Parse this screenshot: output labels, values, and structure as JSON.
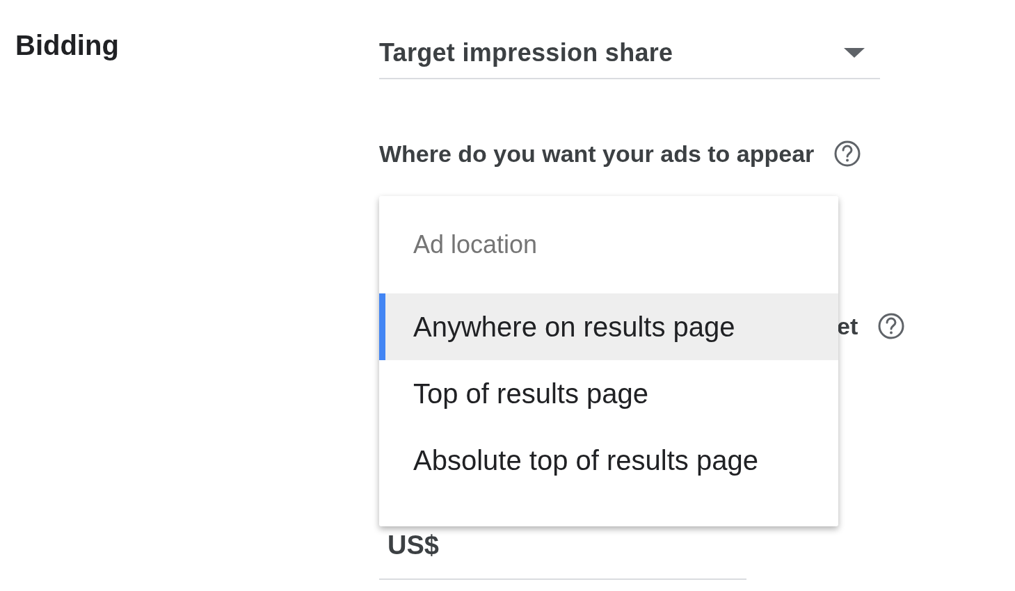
{
  "section": {
    "title": "Bidding"
  },
  "bidding_select": {
    "value": "Target impression share"
  },
  "location_question": {
    "label": "Where do you want your ads to appear"
  },
  "partly_hidden_label": {
    "text": "et"
  },
  "amount_field": {
    "prefix": "US$"
  },
  "ad_location_menu": {
    "header": "Ad location",
    "items": [
      {
        "label": "Anywhere on results page",
        "selected": true
      },
      {
        "label": "Top of results page",
        "selected": false
      },
      {
        "label": "Absolute top of results page",
        "selected": false
      }
    ]
  }
}
